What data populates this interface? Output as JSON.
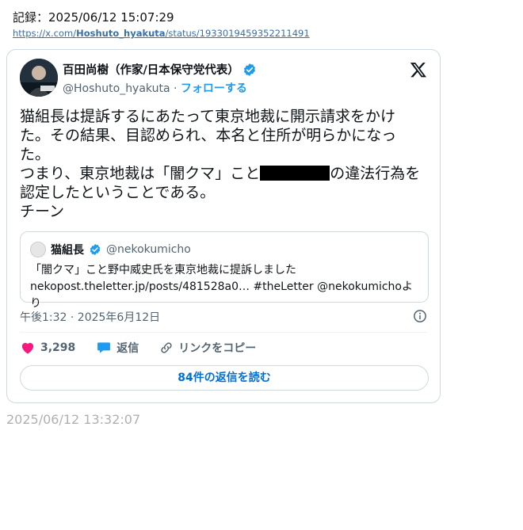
{
  "record": {
    "text": "記録：2025/06/12 15:07:29"
  },
  "source_link": {
    "prefix": "https://x.com/",
    "bold": "Hoshuto_hyakuta",
    "suffix": "/status/1933019459352211491"
  },
  "tweet": {
    "author_name": "百田尚樹（作家/日本保守党代表）",
    "handle": "@Hoshuto_hyakuta",
    "separator": " · ",
    "follow_label": "フォローする",
    "text_part1": "猫組長は提訴するにあたって東京地裁に開示請求をかけた。その結果、目認められ、本名と住所が明らかになった。\nつまり、東京地裁は「闇クマ」こと",
    "text_part2": "の違法行為を認定したということである。\nチーン",
    "timestamp": "午後1:32 · 2025年6月12日",
    "likes": "3,298",
    "reply_label": "返信",
    "copy_link_label": "リンクをコピー",
    "read_replies_label": "84件の返信を読む",
    "quote": {
      "name": "猫組長",
      "handle": "@nekokumicho",
      "line1": "「闇クマ」こと野中威史氏を東京地裁に提訴しました",
      "line2": "nekopost.theletter.jp/posts/481528a0… #theLetter @nekokumichoより"
    }
  },
  "capture_time": "2025/06/12 13:32:07",
  "colors": {
    "verified": "#1d9bf0",
    "like": "#f91880",
    "reply": "#1d9bf0",
    "link_text": "#3b6fa8"
  },
  "icons": {
    "verified": "verified-badge-icon",
    "logo": "x-logo-icon",
    "like": "heart-icon",
    "reply": "speech-bubble-icon",
    "link": "link-icon",
    "info": "info-icon"
  }
}
